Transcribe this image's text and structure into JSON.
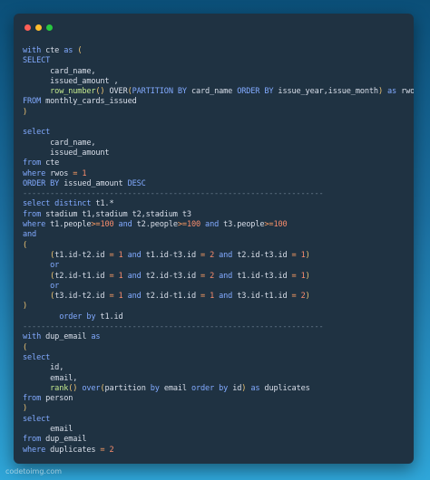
{
  "window": {
    "dots": [
      "close",
      "minimize",
      "maximize"
    ],
    "colors": {
      "close": "#ff5f57",
      "minimize": "#febc2e",
      "maximize": "#28c840"
    }
  },
  "code_lines": [
    [
      [
        "kw",
        "with"
      ],
      [
        "txt",
        " cte "
      ],
      [
        "kw",
        "as"
      ],
      [
        "punc",
        " ("
      ]
    ],
    [
      [
        "kw",
        "SELECT"
      ]
    ],
    [
      [
        "txt",
        "      card_name,"
      ]
    ],
    [
      [
        "txt",
        "      issued_amount ,"
      ]
    ],
    [
      [
        "txt",
        "      "
      ],
      [
        "fn",
        "row_number"
      ],
      [
        "punc",
        "()"
      ],
      [
        "txt",
        " OVER"
      ],
      [
        "punc",
        "("
      ],
      [
        "kw",
        "PARTITION BY"
      ],
      [
        "txt",
        " card_name "
      ],
      [
        "kw",
        "ORDER BY"
      ],
      [
        "txt",
        " issue_year,issue_month"
      ],
      [
        "punc",
        ")"
      ],
      [
        "txt",
        " "
      ],
      [
        "kw",
        "as"
      ],
      [
        "txt",
        " rwos"
      ]
    ],
    [
      [
        "kw",
        "FROM"
      ],
      [
        "txt",
        " monthly_cards_issued"
      ]
    ],
    [
      [
        "punc",
        ")"
      ]
    ],
    [
      [
        "txt",
        ""
      ]
    ],
    [
      [
        "kw",
        "select"
      ]
    ],
    [
      [
        "txt",
        "      card_name,"
      ]
    ],
    [
      [
        "txt",
        "      issued_amount"
      ]
    ],
    [
      [
        "kw",
        "from"
      ],
      [
        "txt",
        " cte"
      ]
    ],
    [
      [
        "kw",
        "where"
      ],
      [
        "txt",
        " rwos "
      ],
      [
        "op",
        "="
      ],
      [
        "txt",
        " "
      ],
      [
        "num",
        "1"
      ]
    ],
    [
      [
        "kw",
        "ORDER BY"
      ],
      [
        "txt",
        " issued_amount "
      ],
      [
        "kw",
        "DESC"
      ]
    ],
    [
      [
        "sep",
        "------------------------------------------------------------------"
      ]
    ],
    [
      [
        "kw",
        "select distinct"
      ],
      [
        "txt",
        " t1.*"
      ]
    ],
    [
      [
        "kw",
        "from"
      ],
      [
        "txt",
        " stadium t1,stadium t2,stadium t3"
      ]
    ],
    [
      [
        "kw",
        "where"
      ],
      [
        "txt",
        " t1.people"
      ],
      [
        "op",
        ">="
      ],
      [
        "num",
        "100"
      ],
      [
        "txt",
        " "
      ],
      [
        "kw",
        "and"
      ],
      [
        "txt",
        " t2.people"
      ],
      [
        "op",
        ">="
      ],
      [
        "num",
        "100"
      ],
      [
        "txt",
        " "
      ],
      [
        "kw",
        "and"
      ],
      [
        "txt",
        " t3.people"
      ],
      [
        "op",
        ">="
      ],
      [
        "num",
        "100"
      ]
    ],
    [
      [
        "kw",
        "and"
      ]
    ],
    [
      [
        "punc",
        "("
      ]
    ],
    [
      [
        "txt",
        "      "
      ],
      [
        "punc",
        "("
      ],
      [
        "txt",
        "t1.id-t2.id "
      ],
      [
        "op",
        "="
      ],
      [
        "txt",
        " "
      ],
      [
        "num",
        "1"
      ],
      [
        "txt",
        " "
      ],
      [
        "kw",
        "and"
      ],
      [
        "txt",
        " t1.id-t3.id "
      ],
      [
        "op",
        "="
      ],
      [
        "txt",
        " "
      ],
      [
        "num",
        "2"
      ],
      [
        "txt",
        " "
      ],
      [
        "kw",
        "and"
      ],
      [
        "txt",
        " t2.id-t3.id "
      ],
      [
        "op",
        "="
      ],
      [
        "txt",
        " "
      ],
      [
        "num",
        "1"
      ],
      [
        "punc",
        ")"
      ]
    ],
    [
      [
        "txt",
        "      "
      ],
      [
        "kw",
        "or"
      ]
    ],
    [
      [
        "txt",
        "      "
      ],
      [
        "punc",
        "("
      ],
      [
        "txt",
        "t2.id-t1.id "
      ],
      [
        "op",
        "="
      ],
      [
        "txt",
        " "
      ],
      [
        "num",
        "1"
      ],
      [
        "txt",
        " "
      ],
      [
        "kw",
        "and"
      ],
      [
        "txt",
        " t2.id-t3.id "
      ],
      [
        "op",
        "="
      ],
      [
        "txt",
        " "
      ],
      [
        "num",
        "2"
      ],
      [
        "txt",
        " "
      ],
      [
        "kw",
        "and"
      ],
      [
        "txt",
        " t1.id-t3.id "
      ],
      [
        "op",
        "="
      ],
      [
        "txt",
        " "
      ],
      [
        "num",
        "1"
      ],
      [
        "punc",
        ")"
      ]
    ],
    [
      [
        "txt",
        "      "
      ],
      [
        "kw",
        "or"
      ]
    ],
    [
      [
        "txt",
        "      "
      ],
      [
        "punc",
        "("
      ],
      [
        "txt",
        "t3.id-t2.id "
      ],
      [
        "op",
        "="
      ],
      [
        "txt",
        " "
      ],
      [
        "num",
        "1"
      ],
      [
        "txt",
        " "
      ],
      [
        "kw",
        "and"
      ],
      [
        "txt",
        " t2.id-t1.id "
      ],
      [
        "op",
        "="
      ],
      [
        "txt",
        " "
      ],
      [
        "num",
        "1"
      ],
      [
        "txt",
        " "
      ],
      [
        "kw",
        "and"
      ],
      [
        "txt",
        " t3.id-t1.id "
      ],
      [
        "op",
        "="
      ],
      [
        "txt",
        " "
      ],
      [
        "num",
        "2"
      ],
      [
        "punc",
        ")"
      ]
    ],
    [
      [
        "punc",
        ")"
      ]
    ],
    [
      [
        "txt",
        "        "
      ],
      [
        "kw",
        "order by"
      ],
      [
        "txt",
        " t1.id"
      ]
    ],
    [
      [
        "sep",
        "------------------------------------------------------------------"
      ]
    ],
    [
      [
        "kw",
        "with"
      ],
      [
        "txt",
        " dup_email "
      ],
      [
        "kw",
        "as"
      ]
    ],
    [
      [
        "punc",
        "("
      ]
    ],
    [
      [
        "kw",
        "select"
      ]
    ],
    [
      [
        "txt",
        "      id,"
      ]
    ],
    [
      [
        "txt",
        "      email,"
      ]
    ],
    [
      [
        "txt",
        "      "
      ],
      [
        "fn",
        "rank"
      ],
      [
        "punc",
        "()"
      ],
      [
        "txt",
        " "
      ],
      [
        "kw",
        "over"
      ],
      [
        "punc",
        "("
      ],
      [
        "txt",
        "partition "
      ],
      [
        "kw",
        "by"
      ],
      [
        "txt",
        " email "
      ],
      [
        "kw",
        "order by"
      ],
      [
        "txt",
        " id"
      ],
      [
        "punc",
        ")"
      ],
      [
        "txt",
        " "
      ],
      [
        "kw",
        "as"
      ],
      [
        "txt",
        " duplicates"
      ]
    ],
    [
      [
        "kw",
        "from"
      ],
      [
        "txt",
        " person"
      ]
    ],
    [
      [
        "punc",
        ")"
      ]
    ],
    [
      [
        "kw",
        "select"
      ]
    ],
    [
      [
        "txt",
        "      email"
      ]
    ],
    [
      [
        "kw",
        "from"
      ],
      [
        "txt",
        " dup_email"
      ]
    ],
    [
      [
        "kw",
        "where"
      ],
      [
        "txt",
        " duplicates "
      ],
      [
        "op",
        "="
      ],
      [
        "txt",
        " "
      ],
      [
        "num",
        "2"
      ]
    ]
  ],
  "watermark": "codetoimg.com"
}
